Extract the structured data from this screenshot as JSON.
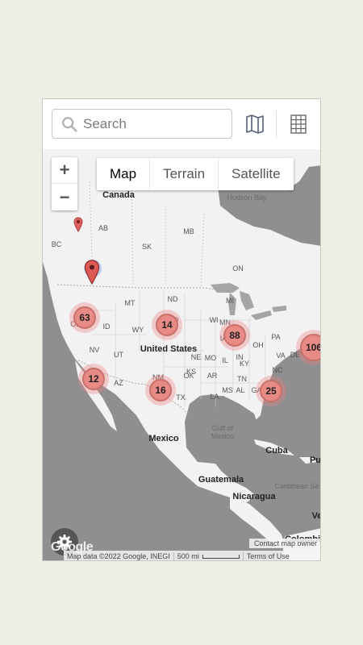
{
  "search": {
    "placeholder": "Search"
  },
  "toolbar": {
    "map_view_icon": "map-icon",
    "grid_view_icon": "grid-icon"
  },
  "zoom": {
    "in": "+",
    "out": "−"
  },
  "map_types": [
    "Map",
    "Terrain",
    "Satellite"
  ],
  "labels": {
    "canada": "Canada",
    "hudson_bay": "Hudson Bay",
    "ab": "AB",
    "bc": "BC",
    "sk": "SK",
    "mb": "MB",
    "on": "ON",
    "mt": "MT",
    "nd": "ND",
    "sd": "SD",
    "wy": "WY",
    "id": "ID",
    "or": "OR",
    "nv": "NV",
    "ut": "UT",
    "az": "AZ",
    "nm": "NM",
    "ok": "OK",
    "tx": "TX",
    "ks": "KS",
    "ne": "NE",
    "ia": "IA",
    "mo": "MO",
    "ar": "AR",
    "la": "LA",
    "ms": "MS",
    "al": "AL",
    "ga": "GA",
    "tn": "TN",
    "ky": "KY",
    "il": "IL",
    "in": "IN",
    "oh": "OH",
    "wi": "WI",
    "mi": "MI",
    "mn": "MN",
    "nc": "NC",
    "va": "VA",
    "pa": "PA",
    "de": "DE",
    "united_states": "United States",
    "gulf": "Gulf of\nMexico",
    "mexico": "Mexico",
    "cuba": "Cuba",
    "pr": "Pu",
    "guatemala": "Guatemala",
    "caribbean": "Caribbean Se",
    "nicaragua": "Nicaragua",
    "colombia": "Colombi",
    "venezuela": "Ve"
  },
  "clusters": [
    {
      "count": "63"
    },
    {
      "count": "14"
    },
    {
      "count": "88"
    },
    {
      "count": "106"
    },
    {
      "count": "12"
    },
    {
      "count": "16"
    },
    {
      "count": "25"
    }
  ],
  "footer": {
    "contact": "Contact map owner",
    "attribution": "Map data ©2022 Google, INEGI",
    "scale": "500 mi",
    "terms": "Terms of Use",
    "google": "Google"
  }
}
